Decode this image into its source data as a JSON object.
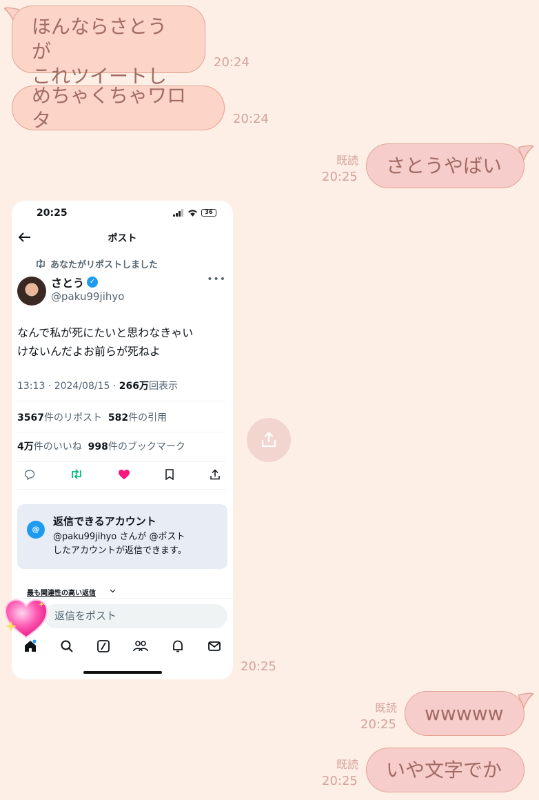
{
  "messages": {
    "m1": {
      "line1": "ほんならさとうが",
      "line2": "これツイートして",
      "time": "20:24"
    },
    "m2": {
      "text": "めちゃくちゃワロタ",
      "time": "20:24"
    },
    "m3": {
      "text": "さとうやばい",
      "read": "既読",
      "time": "20:25"
    },
    "m4": {
      "time": "20:25"
    },
    "m5": {
      "text": "wwwww",
      "read": "既読",
      "time": "20:25"
    },
    "m6": {
      "text": "いや文字でか",
      "read": "既読",
      "time": "20:25"
    }
  },
  "screenshot": {
    "status_time": "20:25",
    "battery": "36",
    "nav_title": "ポスト",
    "repost_notice": "あなたがリポストしました",
    "author_name": "さとう",
    "author_handle": "@paku99jihyo",
    "tweet_line1": "なんで私が死にたいと思わなきゃい",
    "tweet_line2": "けないんだよお前らが死ねよ",
    "timestamp": "13:13 · 2024/08/15 · ",
    "views_num": "266万",
    "views_label": "回表示",
    "reposts_num": "3567",
    "reposts_label": "件のリポスト",
    "quotes_num": "582",
    "quotes_label": "件の引用",
    "likes_num": "4万",
    "likes_label": "件のいいね",
    "bookmarks_num": "998",
    "bookmarks_label": "件のブックマーク",
    "reply_box_title": "返信できるアカウント",
    "reply_box_line1": "@paku99jihyo さんが @ポスト",
    "reply_box_line2": "したアカウントが返信できます。",
    "sort_label": "最も関連性の高い返信",
    "reply_placeholder": "返信をポスト"
  },
  "colors": {
    "background": "#fdeee6",
    "received_bubble": "#fcd5c7",
    "sent_bubble": "#f7cdcb",
    "bubble_text": "#a16b63",
    "like_pink": "#f91880",
    "verified_blue": "#1d9bf0"
  },
  "icons": [
    "back-arrow-icon",
    "repost-icon",
    "verified-icon",
    "more-icon",
    "reply-icon",
    "like-icon",
    "bookmark-icon",
    "share-icon",
    "at-icon",
    "home-icon",
    "search-icon",
    "grok-icon",
    "communities-icon",
    "bell-icon",
    "mail-icon",
    "heart-sticker-icon"
  ]
}
